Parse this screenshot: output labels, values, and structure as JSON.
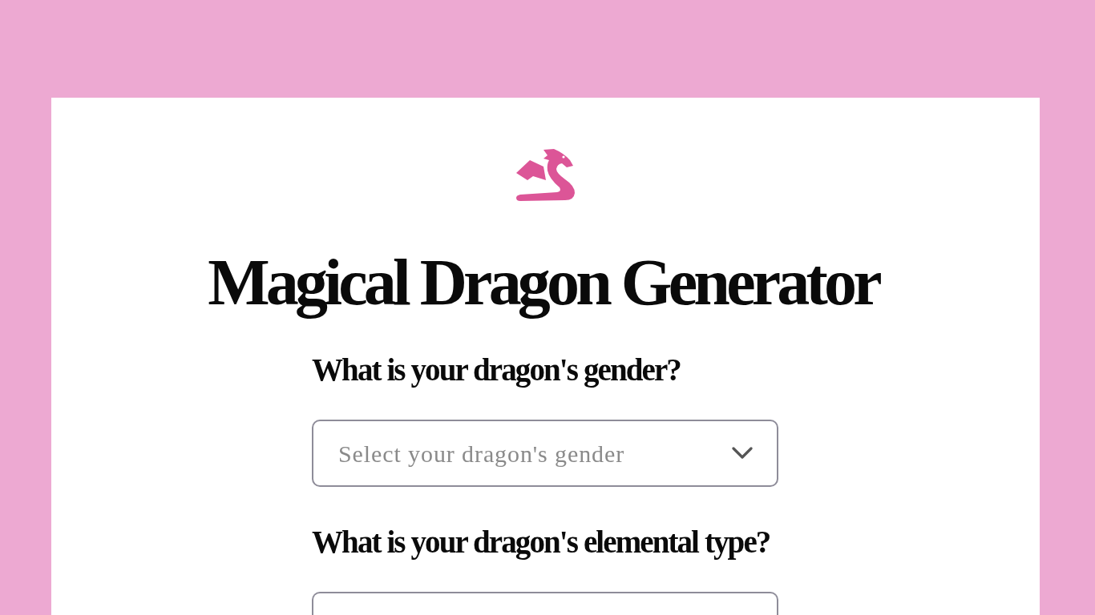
{
  "title": "Magical Dragon Generator",
  "questions": [
    {
      "label": "What is your dragon's gender?",
      "placeholder": "Select your dragon's gender"
    },
    {
      "label": "What is your dragon's elemental type?"
    }
  ]
}
